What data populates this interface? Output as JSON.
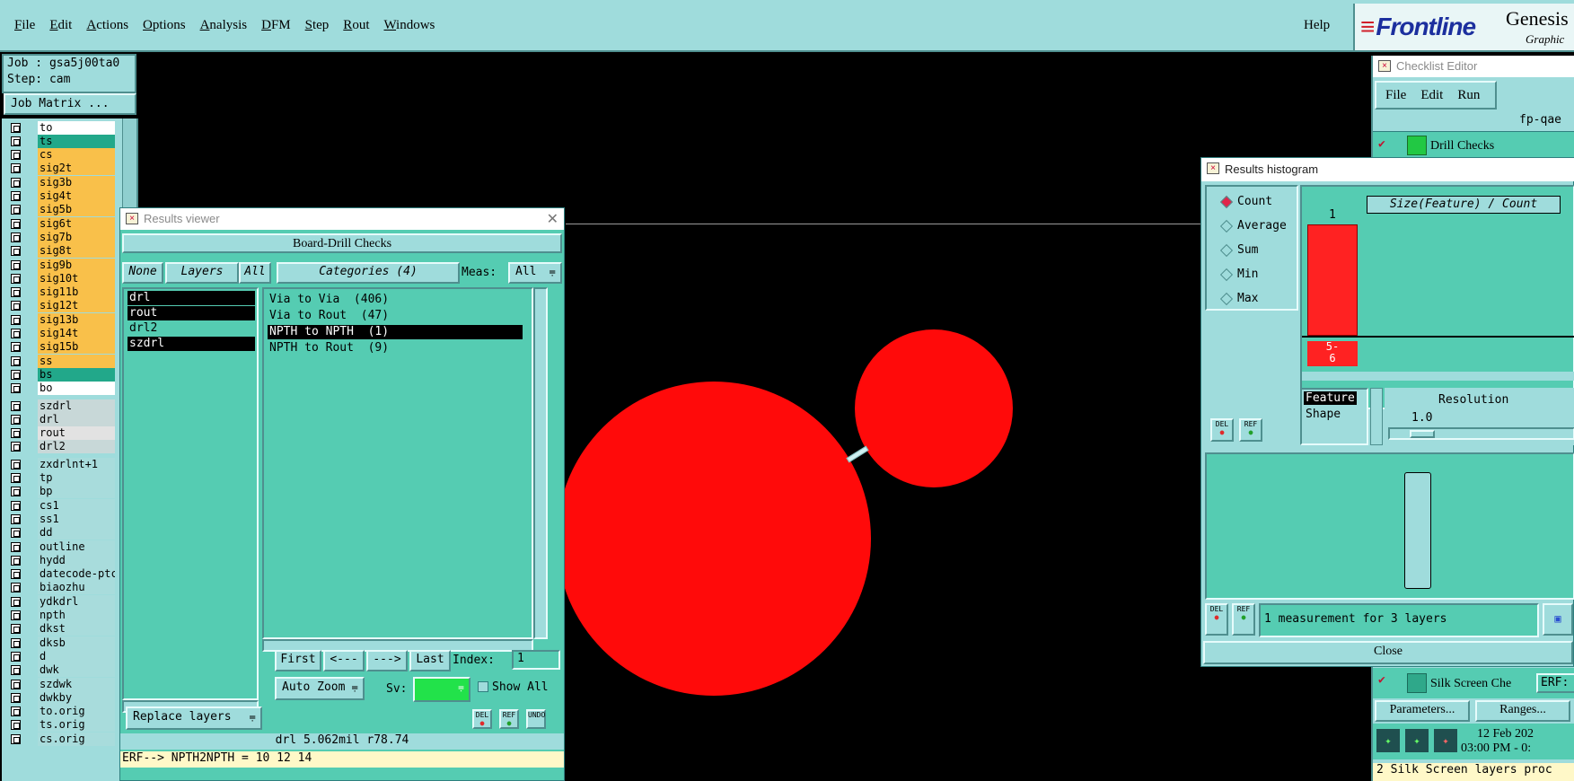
{
  "menubar": {
    "items": [
      "File",
      "Edit",
      "Actions",
      "Options",
      "Analysis",
      "DFM",
      "Step",
      "Rout",
      "Windows"
    ],
    "help": "Help",
    "logo": "Frontline",
    "product": "Genesis",
    "product_sub": "Graphic"
  },
  "job": {
    "job_line": "Job : gsa5j00ta0",
    "step_line": "Step: cam",
    "matrix_button": "Job Matrix ..."
  },
  "layers": [
    {
      "name": "to",
      "color": "white"
    },
    {
      "name": "ts",
      "color": "teal"
    },
    {
      "name": "cs",
      "color": "orange"
    },
    {
      "name": "sig2t",
      "color": "orange"
    },
    {
      "name": "sig3b",
      "color": "orange"
    },
    {
      "name": "sig4t",
      "color": "orange"
    },
    {
      "name": "sig5b",
      "color": "orange"
    },
    {
      "name": "sig6t",
      "color": "orange"
    },
    {
      "name": "sig7b",
      "color": "orange"
    },
    {
      "name": "sig8t",
      "color": "orange"
    },
    {
      "name": "sig9b",
      "color": "orange"
    },
    {
      "name": "sig10t",
      "color": "orange"
    },
    {
      "name": "sig11b",
      "color": "orange"
    },
    {
      "name": "sig12t",
      "color": "orange"
    },
    {
      "name": "sig13b",
      "color": "orange"
    },
    {
      "name": "sig14t",
      "color": "orange"
    },
    {
      "name": "sig15b",
      "color": "orange"
    },
    {
      "name": "ss",
      "color": "orange"
    },
    {
      "name": "bs",
      "color": "teal"
    },
    {
      "name": "bo",
      "color": "white"
    },
    {
      "name": "szdrl",
      "color": "grey"
    },
    {
      "name": "drl",
      "color": "grey"
    },
    {
      "name": "rout",
      "color": "lightgrey"
    },
    {
      "name": "drl2",
      "color": "grey"
    },
    {
      "name": "zxdrlnt+1",
      "color": "cyan"
    },
    {
      "name": "tp",
      "color": "cyan"
    },
    {
      "name": "bp",
      "color": "cyan"
    },
    {
      "name": "cs1",
      "color": "cyan"
    },
    {
      "name": "ss1",
      "color": "cyan"
    },
    {
      "name": "dd",
      "color": "cyan"
    },
    {
      "name": "outline",
      "color": "cyan"
    },
    {
      "name": "hydd",
      "color": "cyan"
    },
    {
      "name": "datecode-ptc",
      "color": "cyan"
    },
    {
      "name": "biaozhu",
      "color": "cyan"
    },
    {
      "name": "ydkdrl",
      "color": "cyan"
    },
    {
      "name": "npth",
      "color": "cyan"
    },
    {
      "name": "dkst",
      "color": "cyan"
    },
    {
      "name": "dksb",
      "color": "cyan"
    },
    {
      "name": "d",
      "color": "cyan"
    },
    {
      "name": "dwk",
      "color": "cyan"
    },
    {
      "name": "szdwk",
      "color": "cyan"
    },
    {
      "name": "dwkby",
      "color": "cyan"
    },
    {
      "name": "to.orig",
      "color": "cyan"
    },
    {
      "name": "ts.orig",
      "color": "cyan"
    },
    {
      "name": "cs.orig",
      "color": "cyan"
    }
  ],
  "results_viewer": {
    "title": "Results viewer",
    "header": "Board-Drill Checks",
    "none_btn": "None",
    "layers_btn": "Layers",
    "all_btn": "All",
    "categories_btn": "Categories (4)",
    "meas_label": "Meas:",
    "meas_value": "All",
    "layer_list": [
      "drl",
      "rout",
      "drl2",
      "szdrl"
    ],
    "category_list": [
      "Via to Via  (406)",
      "Via to Rout  (47)",
      "NPTH to NPTH  (1)",
      "NPTH to Rout  (9)"
    ],
    "first_btn": "First",
    "prev_btn": "<---",
    "next_btn": "--->",
    "last_btn": "Last",
    "index_label": "Index:",
    "index_value": "1",
    "zoom_option": "Auto Zoom",
    "sv_label": "Sv:",
    "show_all_label": "Show All",
    "replace_option": "Replace layers",
    "del_label": "DEL",
    "ref_label": "REF",
    "undo_label": "UNDO",
    "status_line": "drl 5.062mil  r78.74",
    "erf_line": "ERF--> NPTH2NPTH = 10 12 14"
  },
  "checklist_editor": {
    "title": "Checklist Editor",
    "menu": [
      "File",
      "Edit",
      "Run"
    ],
    "checklist_name": "fp-qae",
    "row1": "Drill Checks",
    "row2": "Silk Screen Che",
    "erf_label": "ERF:",
    "parameters_btn": "Parameters...",
    "ranges_btn": "Ranges...",
    "date": "12 Feb 202",
    "time": "03:00 PM - 0:",
    "status": "2 Silk Screen layers proc"
  },
  "histogram": {
    "title": "Results histogram",
    "modes": [
      "Count",
      "Average",
      "Sum",
      "Min",
      "Max"
    ],
    "selected_mode": "Count",
    "chart_title": "Size(Feature) / Count",
    "bar_value": "1",
    "bar_label": "5-\n6",
    "feature_label": "Feature",
    "shape_label": "Shape",
    "resolution_label": "Resolution",
    "resolution_value": "1.0",
    "measurement_status": "1 measurement for 3 layers",
    "close_btn": "Close"
  },
  "colors": {
    "panel": "#9fdcdc",
    "panel_green": "#55ccb2",
    "feature_red": "#ff0a0a",
    "layer_orange": "#f9c04a",
    "layer_teal": "#22a88a"
  }
}
